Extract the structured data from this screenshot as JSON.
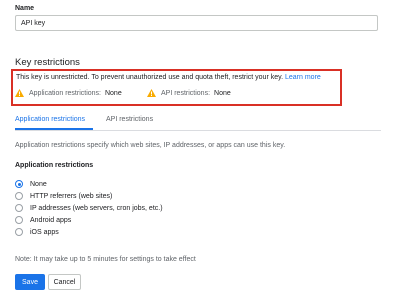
{
  "name_field": {
    "label": "Name",
    "value": "API key"
  },
  "key_restrictions": {
    "title": "Key restrictions",
    "warning_text": "This key is unrestricted. To prevent unauthorized use and quota theft, restrict your key.",
    "learn_more": "Learn more",
    "application_restrictions_label": "Application restrictions:",
    "application_restrictions_value": "None",
    "api_restrictions_label": "API restrictions:",
    "api_restrictions_value": "None"
  },
  "tabs": [
    {
      "label": "Application restrictions",
      "active": true
    },
    {
      "label": "API restrictions",
      "active": false
    }
  ],
  "description": "Application restrictions specify which web sites, IP addresses, or apps can use this key.",
  "restriction_group": {
    "label": "Application restrictions",
    "options": [
      {
        "label": "None",
        "selected": true
      },
      {
        "label": "HTTP referrers (web sites)",
        "selected": false
      },
      {
        "label": "IP addresses (web servers, cron jobs, etc.)",
        "selected": false
      },
      {
        "label": "Android apps",
        "selected": false
      },
      {
        "label": "iOS apps",
        "selected": false
      }
    ]
  },
  "note": "Note: It may take up to 5 minutes for settings to take effect",
  "buttons": {
    "save": "Save",
    "cancel": "Cancel"
  },
  "colors": {
    "accent": "#1a73e8",
    "highlight_border": "#d93025",
    "warning_icon": "#f9ab00"
  },
  "icons": {
    "warning": "warning-triangle-icon"
  }
}
